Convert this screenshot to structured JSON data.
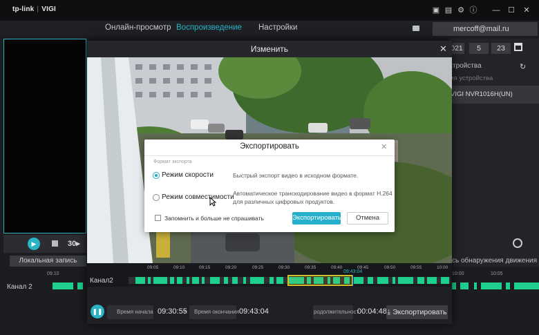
{
  "app": {
    "brand": "tp-link",
    "product": "VIGI"
  },
  "nav": {
    "live": "Онлайн-просмотр",
    "playback": "Воспроизведение",
    "settings": "Настройки"
  },
  "user": {
    "email": "mercoff@mail.ru"
  },
  "date": {
    "d1": "021",
    "d2": "5",
    "d3": "23"
  },
  "devices": {
    "header": "стройства",
    "search_placeholder": "мя устройства",
    "item": "VIGI NVR1016H(UN)"
  },
  "player": {
    "skip_label": "30",
    "record_tab": "Локальная запись"
  },
  "right": {
    "motion_label": "сь обнаружения движения"
  },
  "bottom": {
    "channel": "Канал 2",
    "ticks": [
      "09:10",
      "10:00",
      "10:05"
    ]
  },
  "modal": {
    "title": "Изменить",
    "channel": "Канал2",
    "ticks": [
      "09:05",
      "09:10",
      "09:15",
      "09:20",
      "09:25",
      "09:30",
      "09:35",
      "09:40",
      "09:45",
      "09:50",
      "09:55",
      "10:00"
    ],
    "cursor_time": "09:43:04",
    "start_label": "Время начала",
    "start_value": "09:30:55",
    "dash": "-",
    "end_label": "Время окончания",
    "end_value": "09:43:04",
    "duration_label": "родолжительност",
    "duration_value": "00:04:48",
    "export_btn": "Экспортировать"
  },
  "dialog": {
    "title": "Экспортировать",
    "format_label": "Формат экспорта",
    "opt1": "Режим скорости",
    "opt1_desc": "Быстрый экспорт видео в исходном формате.",
    "opt2": "Режим совместимости",
    "opt2_desc_l1": "Автоматическое транскодирование видео в формат H.264",
    "opt2_desc_l2": "для различных цифровых продуктов.",
    "remember": "Запомнить и больше не спрашивать",
    "export": "Экспортировать",
    "cancel": "Отмена"
  },
  "colors": {
    "accent": "#2ab3c5",
    "green": "#1fcf8e",
    "selection": "#d4c02a"
  }
}
